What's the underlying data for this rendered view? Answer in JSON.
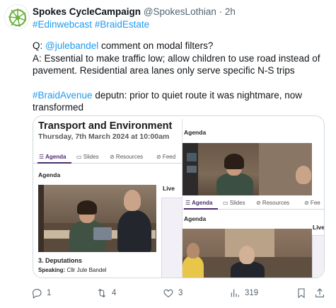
{
  "tweet": {
    "author_name": "Spokes CycleCampaign",
    "author_handle": "@SpokesLothian",
    "time": "· 2h",
    "hashtags_line": [
      {
        "text": "#Edinwebcast",
        "sep": " "
      },
      {
        "text": "#BraidEstate",
        "sep": ""
      }
    ],
    "q_prefix": "Q: ",
    "q_mention": "@julebandel",
    "q_rest": " comment on modal filters?",
    "answer": "A: Essential to make traffic low; allow children to use road instead of pavement. Residential area lanes only serve specific N-S trips",
    "braid_tag": "#BraidAvenue",
    "braid_rest": " deputn: prior to quiet route it was nightmare, now transformed"
  },
  "media": {
    "left": {
      "title": "Transport and Environment",
      "date": "Thursday, 7th March 2024 at 10:00am",
      "tabs": [
        {
          "label": "☰ Agenda"
        },
        {
          "label": "▭ Slides"
        },
        {
          "label": "⊘ Resources"
        },
        {
          "label": "⊘ Feed"
        }
      ],
      "agenda_label": "Agenda",
      "live_label": "Live",
      "item_title": "3. Deputations",
      "speaker_label": "Speaking:",
      "speaker_name": " Cllr Jule Bandel"
    },
    "right": {
      "agenda_label": "Agenda",
      "tabs": [
        {
          "label": "☰ Agenda"
        },
        {
          "label": "▭ Slides"
        },
        {
          "label": "⊘ Resources"
        },
        {
          "label": "⊘ Fee"
        }
      ],
      "agenda_label_2": "Agenda",
      "live_label": "Live"
    }
  },
  "actions": {
    "replies": "1",
    "reposts": "4",
    "likes": "3",
    "views": "319"
  },
  "colors": {
    "link": "#1d9bf0",
    "brand_purple": "#4b2c6f",
    "avatar_green": "#6cb33f"
  },
  "icons": [
    "reply-icon",
    "repost-icon",
    "like-icon",
    "views-icon",
    "bookmark-icon",
    "share-icon"
  ]
}
